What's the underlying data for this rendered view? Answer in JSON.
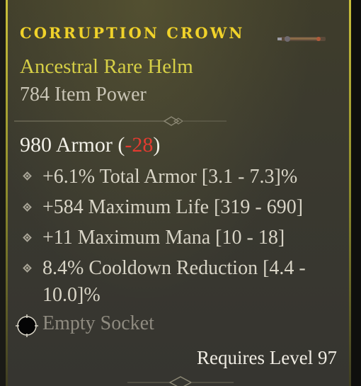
{
  "item": {
    "name": "CORRUPTION CROWN",
    "type_line": "Ancestral Rare Helm",
    "item_power": "784 Item Power",
    "armor": {
      "prefix": "980 Armor  (",
      "delta": "-28",
      "suffix": ")"
    },
    "affixes": [
      {
        "line1": "+6.1% Total Armor [3.1 - 7.3]%",
        "line2": ""
      },
      {
        "line1": "+584 Maximum Life [319 - 690]",
        "line2": ""
      },
      {
        "line1": "+11 Maximum Mana [10 - 18]",
        "line2": ""
      },
      {
        "line1": "8.4% Cooldown Reduction [4.4 -",
        "line2": "10.0]%"
      }
    ],
    "socket": "Empty Socket",
    "requirement": "Requires Level 97"
  },
  "icons": {
    "compare": "weapon-icon",
    "affix_bullet": "diamond-bullet-icon",
    "socket": "empty-socket-icon"
  },
  "colors": {
    "title": "#f0d22a",
    "rare": "#d6cf46",
    "negative_delta": "#e33b30",
    "frame": "#c9bf3a"
  }
}
